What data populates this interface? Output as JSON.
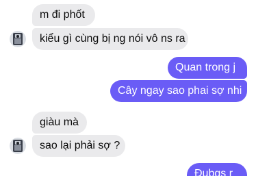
{
  "conversation": {
    "messages": [
      {
        "sender": "contact",
        "text": "m đi phốt"
      },
      {
        "sender": "contact",
        "text": "kiểu gì cùng bị ng nói vô ns ra"
      },
      {
        "sender": "self",
        "text": "Quan trong j"
      },
      {
        "sender": "self",
        "text": "Cây ngay sao phai sợ nhi"
      },
      {
        "sender": "contact",
        "text": "giàu mà"
      },
      {
        "sender": "contact",
        "text": "sao lại phải sợ ?"
      },
      {
        "sender": "self",
        "text": "Đubgs r"
      }
    ]
  },
  "colors": {
    "incoming_bubble": "#eaeaec",
    "outgoing_bubble": "#6a5cf6",
    "background": "#ffffff"
  },
  "icons": {
    "avatar": "contact-avatar-icon"
  }
}
